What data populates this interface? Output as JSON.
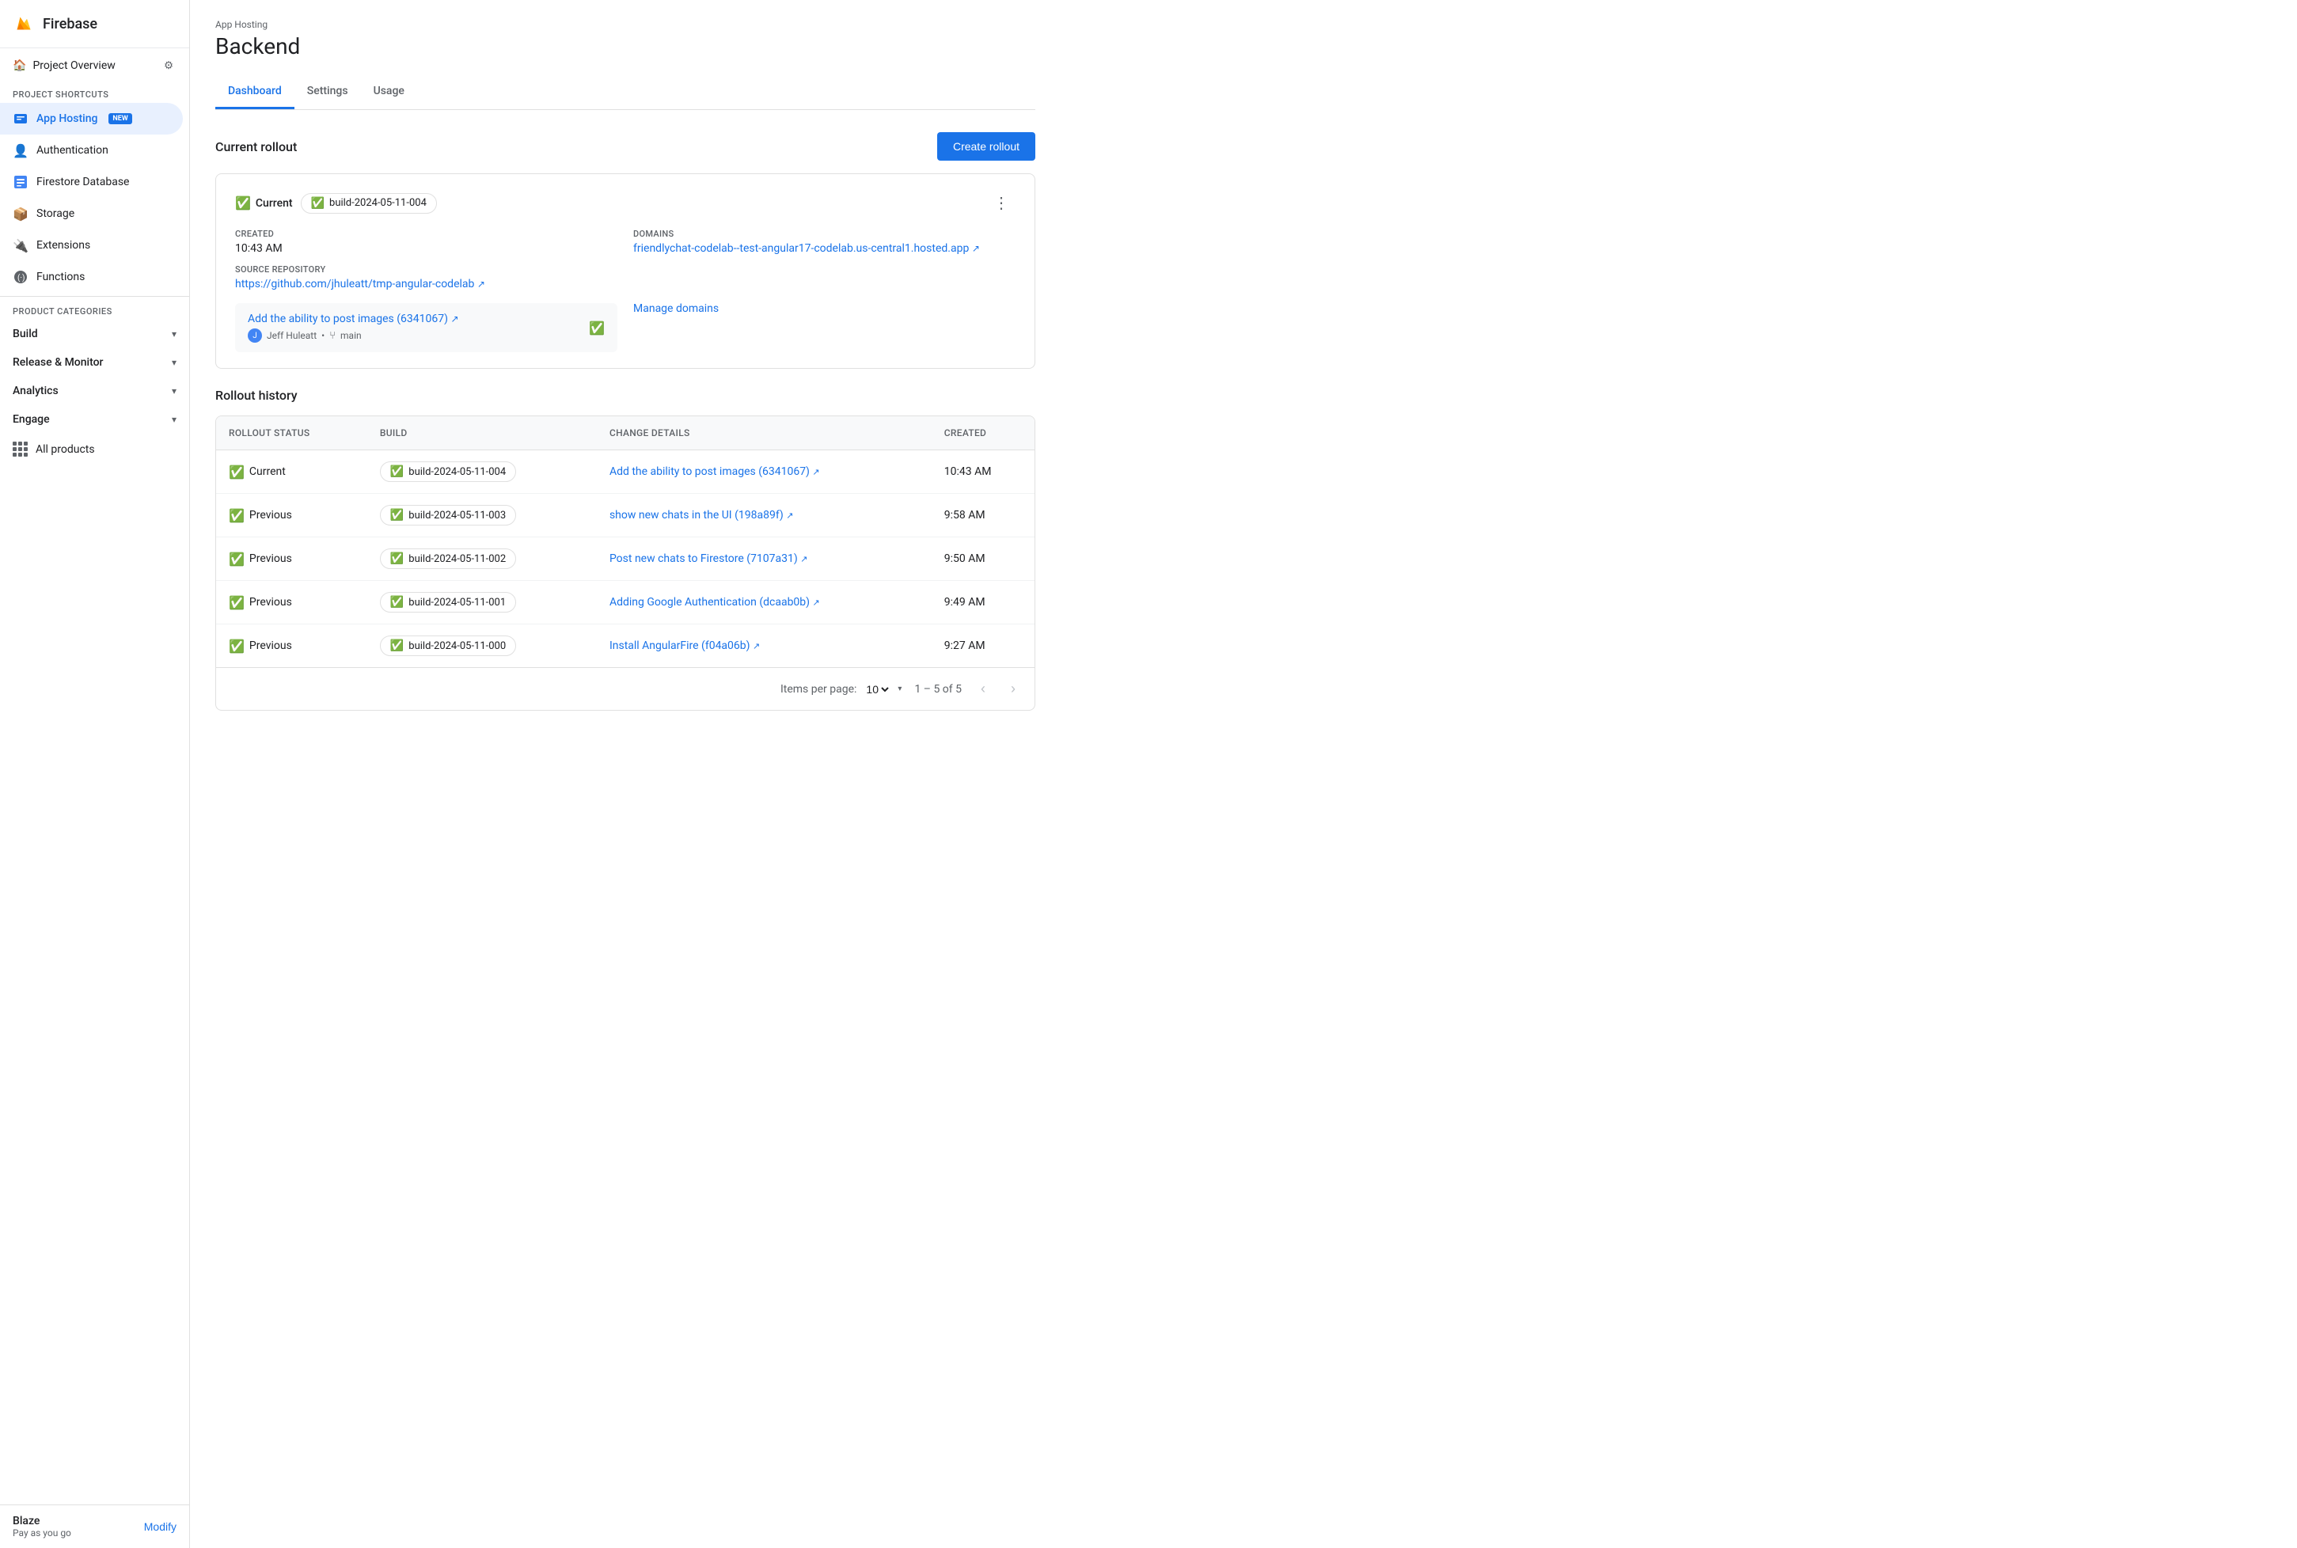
{
  "app": {
    "title": "Firebase"
  },
  "sidebar": {
    "project_overview": "Project Overview",
    "project_shortcuts_label": "Project shortcuts",
    "product_categories_label": "Product categories",
    "nav_items": [
      {
        "id": "app-hosting",
        "label": "App Hosting",
        "badge": "NEW",
        "active": true,
        "icon": "🔷"
      },
      {
        "id": "authentication",
        "label": "Authentication",
        "icon": "👤"
      },
      {
        "id": "firestore",
        "label": "Firestore Database",
        "icon": "🗄️"
      },
      {
        "id": "storage",
        "label": "Storage",
        "icon": "📦"
      },
      {
        "id": "extensions",
        "label": "Extensions",
        "icon": "🔌"
      },
      {
        "id": "functions",
        "label": "Functions",
        "icon": "⚙️"
      }
    ],
    "categories": [
      {
        "id": "build",
        "label": "Build"
      },
      {
        "id": "release-monitor",
        "label": "Release & Monitor"
      },
      {
        "id": "analytics",
        "label": "Analytics"
      },
      {
        "id": "engage",
        "label": "Engage"
      }
    ],
    "all_products": "All products",
    "footer": {
      "plan": "Blaze",
      "subtitle": "Pay as you go",
      "modify": "Modify"
    }
  },
  "header": {
    "breadcrumb": "App Hosting",
    "title": "Backend"
  },
  "tabs": [
    {
      "id": "dashboard",
      "label": "Dashboard",
      "active": true
    },
    {
      "id": "settings",
      "label": "Settings"
    },
    {
      "id": "usage",
      "label": "Usage"
    }
  ],
  "current_rollout": {
    "section_title": "Current rollout",
    "create_btn": "Create rollout",
    "status": "Current",
    "build_id": "build-2024-05-11-004",
    "created_label": "Created",
    "created_time": "10:43 AM",
    "source_repo_label": "Source repository",
    "source_repo_url": "https://github.com/jhuleatt/tmp-angular-codelab",
    "domains_label": "Domains",
    "domain_url": "friendlychat-codelab--test-angular17-codelab.us-central1.hosted.app",
    "commit_message": "Add the ability to post images (6341067)",
    "commit_author": "Jeff Huleatt",
    "commit_branch": "main",
    "manage_domains": "Manage domains"
  },
  "rollout_history": {
    "section_title": "Rollout history",
    "columns": [
      "Rollout Status",
      "Build",
      "Change details",
      "Created"
    ],
    "rows": [
      {
        "status": "Current",
        "build": "build-2024-05-11-004",
        "change": "Add the ability to post images (6341067)",
        "created": "10:43 AM"
      },
      {
        "status": "Previous",
        "build": "build-2024-05-11-003",
        "change": "show new chats in the UI (198a89f)",
        "created": "9:58 AM"
      },
      {
        "status": "Previous",
        "build": "build-2024-05-11-002",
        "change": "Post new chats to Firestore (7107a31)",
        "created": "9:50 AM"
      },
      {
        "status": "Previous",
        "build": "build-2024-05-11-001",
        "change": "Adding Google Authentication (dcaab0b)",
        "created": "9:49 AM"
      },
      {
        "status": "Previous",
        "build": "build-2024-05-11-000",
        "change": "Install AngularFire (f04a06b)",
        "created": "9:27 AM"
      }
    ],
    "pagination": {
      "items_per_page_label": "Items per page:",
      "per_page": "10",
      "page_info": "1 – 5 of 5"
    }
  }
}
